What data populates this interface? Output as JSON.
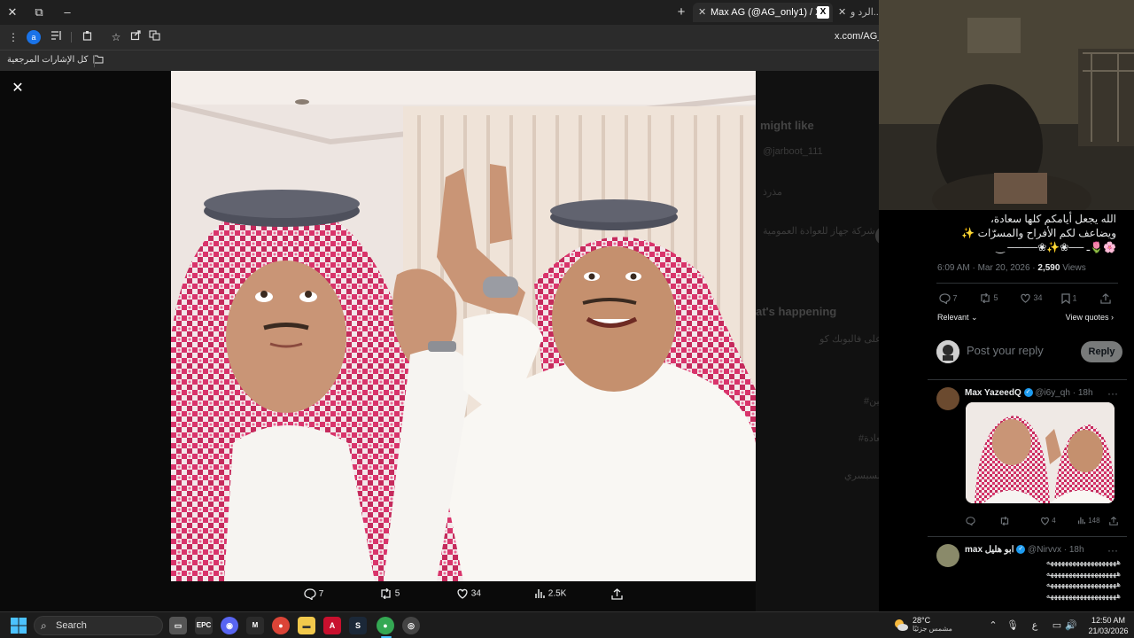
{
  "browser": {
    "window_controls": {
      "close": "✕",
      "restore": "⧉",
      "minimize": "–"
    },
    "new_tab": "+",
    "tabs": [
      {
        "label": "Max AG (@AG_only1) / X",
        "favicon": "X",
        "close": "✕"
      },
      {
        "label": "الرد و...",
        "close": "✕"
      }
    ],
    "address": "x.com/AG_o",
    "profile_initial": "a",
    "bookmarks_label": "كل الإشارات المرجعية"
  },
  "media_viewer": {
    "close": "✕",
    "actions": {
      "replies": "7",
      "reposts": "5",
      "likes": "34",
      "views": "2.5K"
    }
  },
  "background_page": {
    "might_like": "might like",
    "user1_handle": "@jarboot_111",
    "user1_name": "مذرذ",
    "user2_name": "شركة جهاز للعوادة العمومية",
    "whats_happening": "at's happening",
    "trend1": "أحمرك على فالبوبك كو",
    "trend2": "#وتين___العين",
    "trend3": "#يوم_السعادة",
    "trend4": "اللاعب السبسري"
  },
  "tweet": {
    "text": "الله يجعل أيامكم كلها سعادة،\nويضاعف لكم الأفراح والمسرّات ✨\n🌸🌷ـ ──❀✨❀──── ‿",
    "time": "6:09 AM · Mar 20, 2026 · ",
    "views_count": "2,590",
    "views_label": " Views",
    "replies": "7",
    "reposts": "5",
    "likes": "34",
    "bookmarks": "1",
    "sort_label": "Relevant",
    "view_quotes": "View quotes"
  },
  "reply_composer": {
    "placeholder": "Post your reply",
    "button": "Reply"
  },
  "replies": [
    {
      "name": "Max YazeedQ",
      "handle": "@i6y_qh",
      "time": "· 18h",
      "more": "···",
      "actions": {
        "likes": "4",
        "views": "148"
      }
    },
    {
      "name": "max ابو هليل",
      "handle": "@Nirvvx",
      "time": "· 18h",
      "more": "···",
      "text": "هههههههههههههههههههه\nهههههههههههههههههههه\nهههههههههههههههههههه\nهههههههههههههههههههه"
    }
  ],
  "taskbar": {
    "search_label": "Search",
    "weather_temp": "28°C",
    "weather_cond": "مشمس جزئيًا",
    "lang": "ع",
    "time": "12:50 AM",
    "date": "21/03/2026"
  },
  "colors": {
    "x_blue": "#1d9bf0",
    "text": "#e7e9ea",
    "muted": "#71767b",
    "divider": "#2f3336",
    "keffiyeh_red": "#d9346b"
  }
}
